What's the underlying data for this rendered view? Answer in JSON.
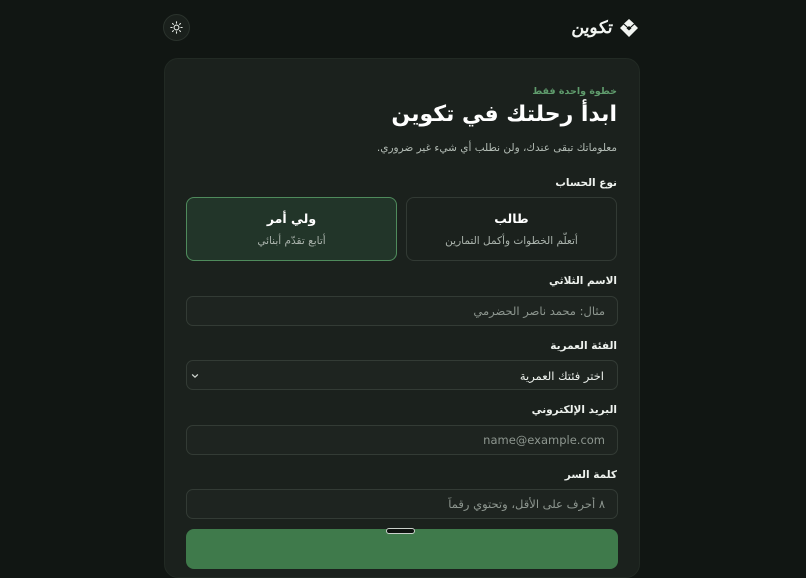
{
  "header": {
    "brand": "تكوين",
    "theme_toggle_icon": "sun-icon",
    "logo_icon": "diamond-logo-icon"
  },
  "form": {
    "eyebrow": "خطوة واحدة فقط",
    "title": "ابدأ رحلتك في تكوين",
    "subtitle": "معلوماتك تبقى عندك، ولن نطلب أي شيء غير ضروري.",
    "account_type": {
      "label": "نوع الحساب",
      "selected": "guardian",
      "options": [
        {
          "id": "student",
          "title": "طالب",
          "desc": "أتعلّم الخطوات وأكمل التمارين"
        },
        {
          "id": "guardian",
          "title": "ولي أمر",
          "desc": "أتابع تقدّم أبنائي"
        }
      ]
    },
    "full_name": {
      "label": "الاسم الثلاثي",
      "value": "",
      "placeholder": "مثال: محمد ناصر الحضرمي"
    },
    "age_group": {
      "label": "الفئة العمرية",
      "selected_value": "اختر فئتك العمرية"
    },
    "email": {
      "label": "البريد الإلكتروني",
      "value": "",
      "placeholder": "name@example.com"
    },
    "password": {
      "label": "كلمة السر",
      "value": "",
      "placeholder": "٨ أحرف على الأقل، وتحتوي رقماً"
    }
  },
  "colors": {
    "background": "#111613",
    "card": "#1b211d",
    "accent": "#3f7a4b",
    "accent_text": "#5f9b6c"
  }
}
